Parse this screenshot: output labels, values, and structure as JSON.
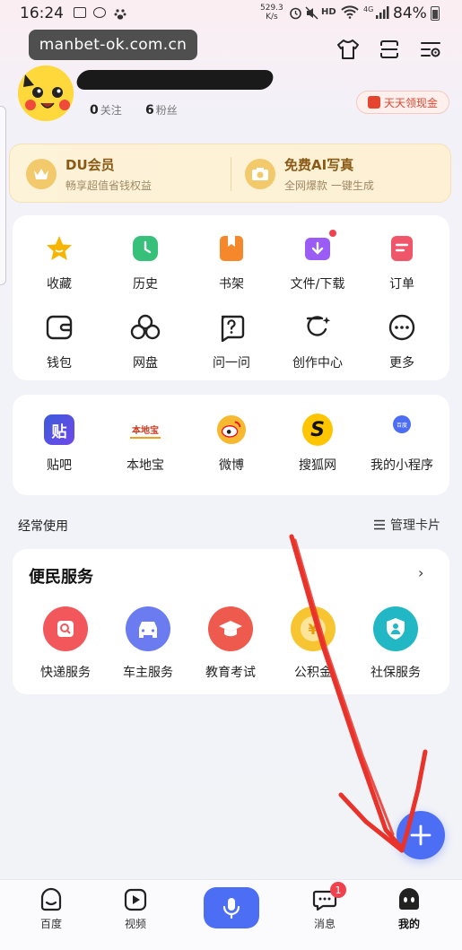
{
  "status_bar": {
    "time": "16:24",
    "net_speed_value": "529.3",
    "net_speed_unit": "K/s",
    "hd": "HD",
    "network": "4G",
    "battery": "84%"
  },
  "watermark": "manbet-ok.com.cn",
  "profile": {
    "following_count": "0",
    "following_label": "关注",
    "fans_count": "6",
    "fans_label": "粉丝",
    "cash_button": "天天领现金"
  },
  "vip": [
    {
      "title": "DU会员",
      "subtitle": "畅享超值省钱权益",
      "icon": "crown-icon"
    },
    {
      "title": "免费AI写真",
      "subtitle": "全网爆款 一键生成",
      "icon": "camera-icon"
    }
  ],
  "tools": [
    {
      "label": "收藏",
      "icon": "star-icon",
      "color": "#f7b500"
    },
    {
      "label": "历史",
      "icon": "clock-icon",
      "color": "#37c07a"
    },
    {
      "label": "书架",
      "icon": "bookshelf-icon",
      "color": "#f5882a"
    },
    {
      "label": "文件/下载",
      "icon": "download-icon",
      "color": "#9b5cf6",
      "dot": true
    },
    {
      "label": "订单",
      "icon": "order-icon",
      "color": "#f0566a"
    },
    {
      "label": "钱包",
      "icon": "wallet-icon",
      "color": "#222"
    },
    {
      "label": "网盘",
      "icon": "cloud-drive-icon",
      "color": "#222"
    },
    {
      "label": "问一问",
      "icon": "question-icon",
      "color": "#222"
    },
    {
      "label": "创作中心",
      "icon": "create-icon",
      "color": "#222"
    },
    {
      "label": "更多",
      "icon": "more-icon",
      "color": "#222"
    }
  ],
  "apps": [
    {
      "label": "贴吧",
      "icon": "tieba-icon",
      "logo_text": "贴"
    },
    {
      "label": "本地宝",
      "icon": "bendibao-icon",
      "logo_text": "本地宝"
    },
    {
      "label": "微博",
      "icon": "weibo-icon"
    },
    {
      "label": "搜狐网",
      "icon": "sohu-icon",
      "logo_text": "S"
    },
    {
      "label": "我的小程序",
      "icon": "mini-program-icon",
      "logo_text": "百度"
    }
  ],
  "section": {
    "title": "经常使用",
    "manage_label": "管理卡片"
  },
  "services": {
    "title": "便民服务",
    "arrow": "›",
    "items": [
      {
        "label": "快递服务",
        "icon": "express-icon",
        "color": "#f2575b"
      },
      {
        "label": "车主服务",
        "icon": "car-icon",
        "color": "#6a7cf0"
      },
      {
        "label": "教育考试",
        "icon": "graduation-icon",
        "color": "#ef5a4e"
      },
      {
        "label": "公积金",
        "icon": "fund-icon",
        "color": "#f7c531",
        "symbol": "¥"
      },
      {
        "label": "社保服务",
        "icon": "social-security-icon",
        "color": "#21b7c4"
      }
    ]
  },
  "bottom_nav": [
    {
      "label": "百度",
      "icon": "home-icon"
    },
    {
      "label": "视频",
      "icon": "video-icon"
    },
    {
      "label": "",
      "icon": "mic-icon"
    },
    {
      "label": "消息",
      "icon": "message-icon",
      "badge": "1"
    },
    {
      "label": "我的",
      "icon": "me-icon"
    }
  ],
  "colors": {
    "accent": "#4c6ef5",
    "annotation_arrow": "#e8322a"
  }
}
